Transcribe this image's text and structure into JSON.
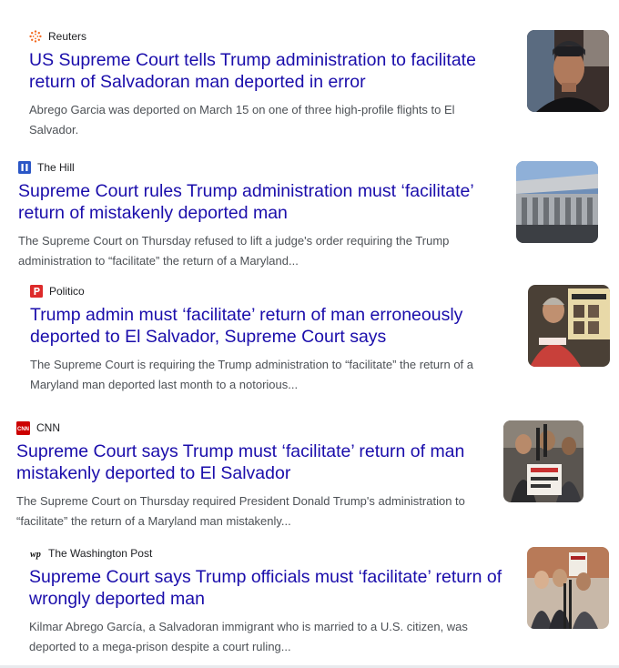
{
  "articles": [
    {
      "source": "Reuters",
      "icon": "reuters-logo-icon",
      "title": "US Supreme Court tells Trump administration to facilitate return of Salvadoran man deported in error",
      "snippet": "Abrego Garcia was deported on March 15 on one of three high-profile flights to El Salvador."
    },
    {
      "source": "The Hill",
      "icon": "the-hill-logo-icon",
      "title": "Supreme Court rules Trump administration must ‘facilitate’ return of mistakenly deported man",
      "snippet": "The Supreme Court on Thursday refused to lift a judge's order requiring the Trump administration to “facilitate” the return of a Maryland..."
    },
    {
      "source": "Politico",
      "icon": "politico-logo-icon",
      "title": "Trump admin must ‘facilitate’ return of man erroneously deported to El Salvador, Supreme Court says",
      "snippet": "The Supreme Court is requiring the Trump administration to “facilitate” the return of a Maryland man deported last month to a notorious..."
    },
    {
      "source": "CNN",
      "icon": "cnn-logo-icon",
      "title": "Supreme Court says Trump must ‘facilitate’ return of man mistakenly deported to El Salvador",
      "snippet": "The Supreme Court on Thursday required President Donald Trump's administration to “facilitate” the return of a Maryland man mistakenly..."
    },
    {
      "source": "The Washington Post",
      "icon": "washington-post-logo-icon",
      "title": "Supreme Court says Trump officials must ‘facilitate’ return of wrongly deported man",
      "snippet": "Kilmar Abrego García, a Salvadoran immigrant who is married to a U.S. citizen, was deported to a mega-prison despite a court ruling..."
    }
  ],
  "colors": {
    "headline": "#1a0dab",
    "snippet": "#4d5156",
    "source": "#202124",
    "reuters": "#f26a21",
    "the_hill": "#2a56c6",
    "politico": "#dd2a2a",
    "cnn": "#cc0000"
  }
}
